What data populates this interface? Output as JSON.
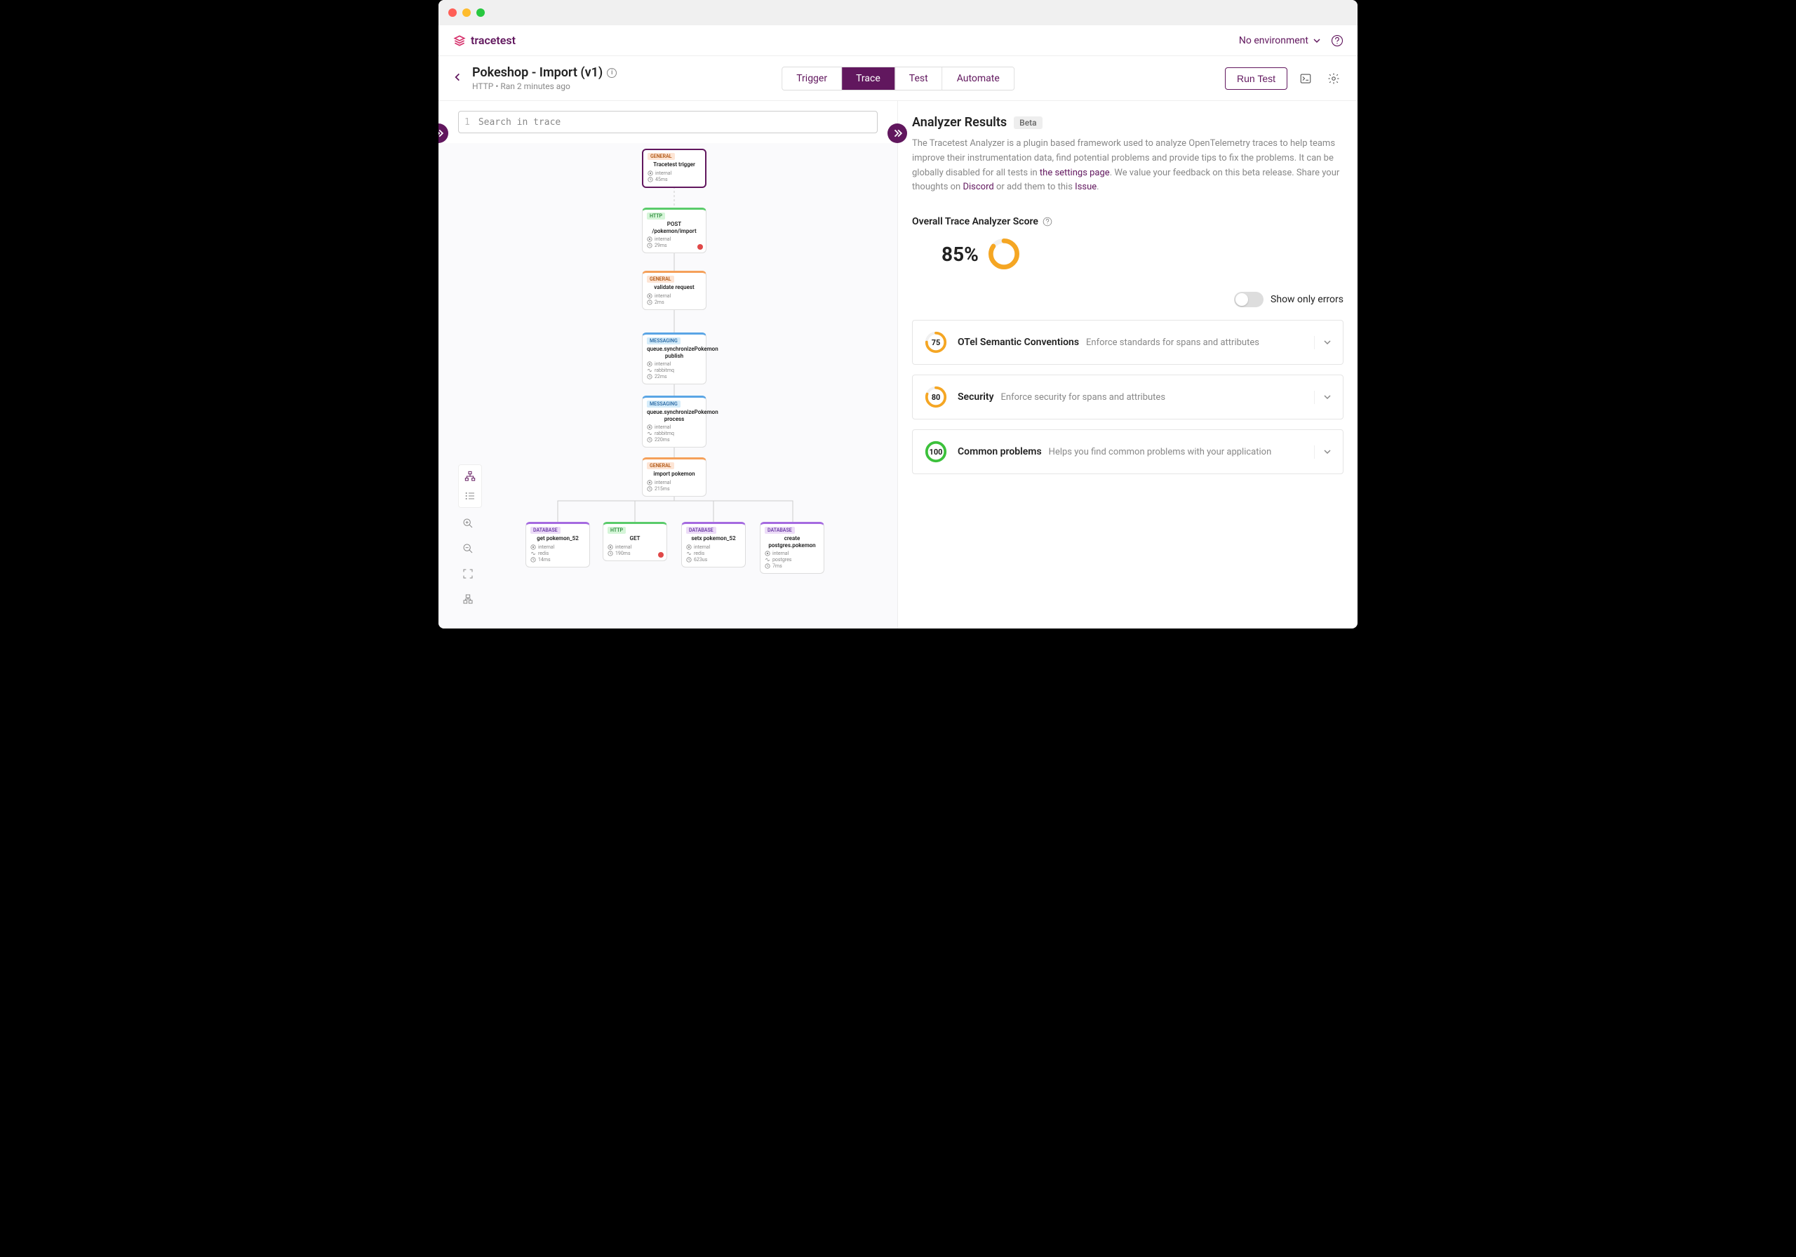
{
  "brand": "tracetest",
  "env_selector": "No environment",
  "page": {
    "title": "Pokeshop - Import (v1)",
    "meta": "HTTP • Ran 2 minutes ago"
  },
  "tabs": {
    "trigger": "Trigger",
    "trace": "Trace",
    "test": "Test",
    "automate": "Automate"
  },
  "run_button": "Run Test",
  "search_placeholder": "Search in trace",
  "search_lineno": "1",
  "nodes": {
    "n1": {
      "tag": "General",
      "title": "Tracetest trigger",
      "attr1": "internal",
      "attr2": "45ms"
    },
    "n2": {
      "tag": "HTTP",
      "title": "POST /pokemon/import",
      "attr1": "internal",
      "attr2": "29ms"
    },
    "n3": {
      "tag": "General",
      "title": "validate request",
      "attr1": "internal",
      "attr2": "2ms"
    },
    "n4": {
      "tag": "Messaging",
      "title": "queue.synchronizePokemon publish",
      "attr1": "internal",
      "attr2": "rabbitmq",
      "attr3": "22ms"
    },
    "n5": {
      "tag": "Messaging",
      "title": "queue.synchronizePokemon process",
      "attr1": "internal",
      "attr2": "rabbitmq",
      "attr3": "220ms"
    },
    "n6": {
      "tag": "General",
      "title": "import pokemon",
      "attr1": "internal",
      "attr2": "215ms"
    },
    "n7": {
      "tag": "Database",
      "title": "get pokemon_52",
      "attr1": "internal",
      "attr2": "redis",
      "attr3": "14ms"
    },
    "n8": {
      "tag": "HTTP",
      "title": "GET",
      "attr1": "internal",
      "attr2": "190ms"
    },
    "n9": {
      "tag": "Database",
      "title": "setx pokemon_52",
      "attr1": "internal",
      "attr2": "redis",
      "attr3": "623us"
    },
    "n10": {
      "tag": "Database",
      "title": "create postgres.pokemon",
      "attr1": "internal",
      "attr2": "postgres",
      "attr3": "7ms"
    }
  },
  "analyzer": {
    "title": "Analyzer Results",
    "beta": "Beta",
    "desc_1": "The Tracetest Analyzer is a plugin based framework used to analyze OpenTelemetry traces to help teams improve their instrumentation data, find potential problems and provide tips to fix the problems. It can be globally disabled for all tests in ",
    "link_settings": "the settings page",
    "desc_2": ". We value your feedback on this beta release. Share your thoughts on ",
    "link_discord": "Discord",
    "desc_3": " or add them to this ",
    "link_issue": "Issue",
    "desc_4": ".",
    "score_label": "Overall Trace Analyzer Score",
    "score_value": "85%",
    "toggle_label": "Show only errors",
    "rules": [
      {
        "score": "75",
        "name": "OTel Semantic Conventions",
        "desc": "Enforce standards for spans and attributes",
        "color": "#f5a623"
      },
      {
        "score": "80",
        "name": "Security",
        "desc": "Enforce security for spans and attributes",
        "color": "#f5a623"
      },
      {
        "score": "100",
        "name": "Common problems",
        "desc": "Helps you find common problems with your application",
        "color": "#3cc13b"
      }
    ]
  }
}
